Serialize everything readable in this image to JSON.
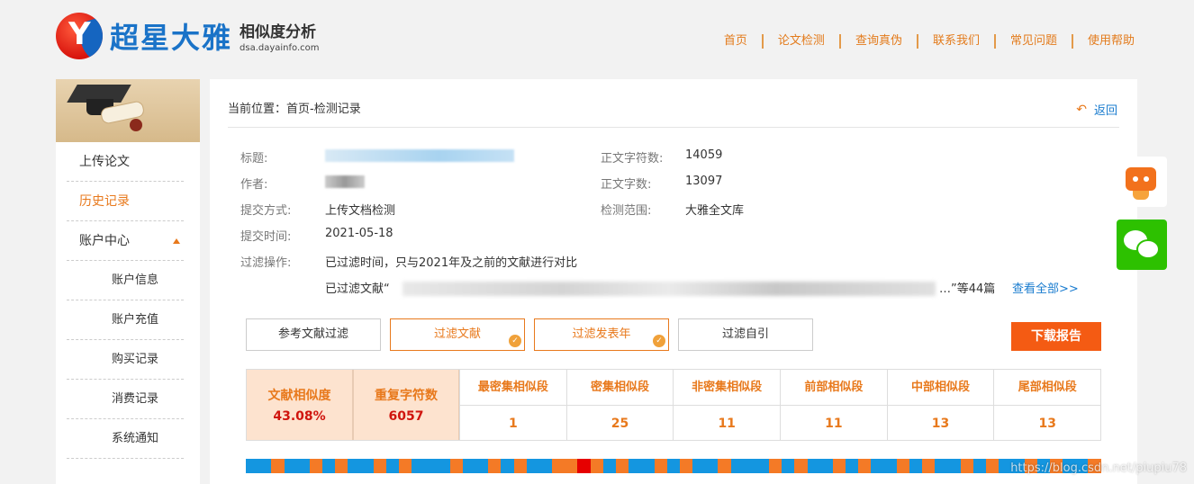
{
  "logo": {
    "mark": "Y",
    "name": "超星大雅",
    "subtitle": "相似度分析",
    "domain": "dsa.dayainfo.com"
  },
  "nav": [
    "首页",
    "论文检测",
    "查询真伪",
    "联系我们",
    "常见问题",
    "使用帮助"
  ],
  "sidebar": {
    "items": [
      {
        "label": "上传论文"
      },
      {
        "label": "历史记录"
      },
      {
        "label": "账户中心"
      },
      {
        "label": "账户信息"
      },
      {
        "label": "账户充值"
      },
      {
        "label": "购买记录"
      },
      {
        "label": "消费记录"
      },
      {
        "label": "系统通知"
      }
    ]
  },
  "breadcrumb": "当前位置：首页-检测记录",
  "back_label": "返回",
  "details": {
    "title_label": "标题:",
    "author_label": "作者:",
    "method_label": "提交方式:",
    "method_value": "上传文档检测",
    "time_label": "提交时间:",
    "time_value": "2021-05-18",
    "filter_label": "过滤操作:",
    "filter_value": "已过滤时间，只与2021年及之前的文献进行对比",
    "lit_prefix": "已过滤文献“",
    "lit_suffix": "…”等44篇",
    "view_all": "查看全部>>",
    "char_count_label": "正文字符数:",
    "char_count_value": "14059",
    "word_count_label": "正文字数:",
    "word_count_value": "13097",
    "scope_label": "检测范围:",
    "scope_value": "大雅全文库"
  },
  "filters": [
    {
      "label": "参考文献过滤",
      "selected": false
    },
    {
      "label": "过滤文献",
      "selected": true
    },
    {
      "label": "过滤发表年",
      "selected": true
    },
    {
      "label": "过滤自引",
      "selected": false
    }
  ],
  "download_label": "下载报告",
  "stats": {
    "similarity_label": "文献相似度",
    "similarity_value": "43.08%",
    "repeat_label": "重复字符数",
    "repeat_value": "6057",
    "columns": [
      {
        "label": "最密集相似段",
        "value": "1"
      },
      {
        "label": "密集相似段",
        "value": "25"
      },
      {
        "label": "非密集相似段",
        "value": "11"
      },
      {
        "label": "前部相似段",
        "value": "11"
      },
      {
        "label": "中部相似段",
        "value": "13"
      },
      {
        "label": "尾部相似段",
        "value": "13"
      }
    ]
  },
  "colors": {
    "accent": "#e8791c",
    "download": "#f45b13",
    "bar_blue": "#1496e0",
    "bar_orange": "#f47a26",
    "bar_red": "#e60000"
  },
  "watermark": "https://blog.csdn.net/piupiu78"
}
